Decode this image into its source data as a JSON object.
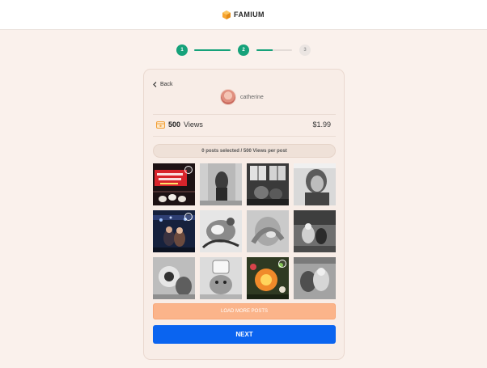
{
  "brand": {
    "name": "FAMIUM",
    "logo_icon": "cube-logo-icon",
    "accent": "#f7a531"
  },
  "stepper": {
    "steps": [
      {
        "label": "1",
        "state": "done"
      },
      {
        "label": "2",
        "state": "done"
      },
      {
        "label": "3",
        "state": "todo"
      }
    ],
    "connectors": [
      {
        "progress": 1.0
      },
      {
        "progress": 0.45
      }
    ],
    "active_color": "#16a27a"
  },
  "card": {
    "back_label": "Back",
    "back_icon": "chevron-left-icon",
    "user": {
      "name": "catherine",
      "avatar_icon": "profile-avatar"
    },
    "package": {
      "icon": "calendar-icon",
      "count": "500",
      "unit": "Views",
      "price": "$1.99"
    },
    "selection_status": "0 posts selected / 500 Views per post",
    "posts": [
      {
        "thumb": "red-banner",
        "selected_marker": true
      },
      {
        "thumb": "dark-figure",
        "selected_marker": false
      },
      {
        "thumb": "window-room",
        "selected_marker": false
      },
      {
        "thumb": "portrait-grey",
        "selected_marker": false
      },
      {
        "thumb": "night-lights",
        "selected_marker": true
      },
      {
        "thumb": "bw-hands",
        "selected_marker": false
      },
      {
        "thumb": "blurry-face",
        "selected_marker": false
      },
      {
        "thumb": "outdoor-group",
        "selected_marker": false
      },
      {
        "thumb": "bw-closeup",
        "selected_marker": false
      },
      {
        "thumb": "dog-bw",
        "selected_marker": false
      },
      {
        "thumb": "flower-color",
        "selected_marker": true
      },
      {
        "thumb": "couple-bw",
        "selected_marker": false
      }
    ],
    "load_more_label": "LOAD MORE POSTS",
    "next_label": "NEXT"
  },
  "colors": {
    "load_more": "#fbb48a",
    "next": "#0a64f0",
    "background": "#faf1ec"
  }
}
